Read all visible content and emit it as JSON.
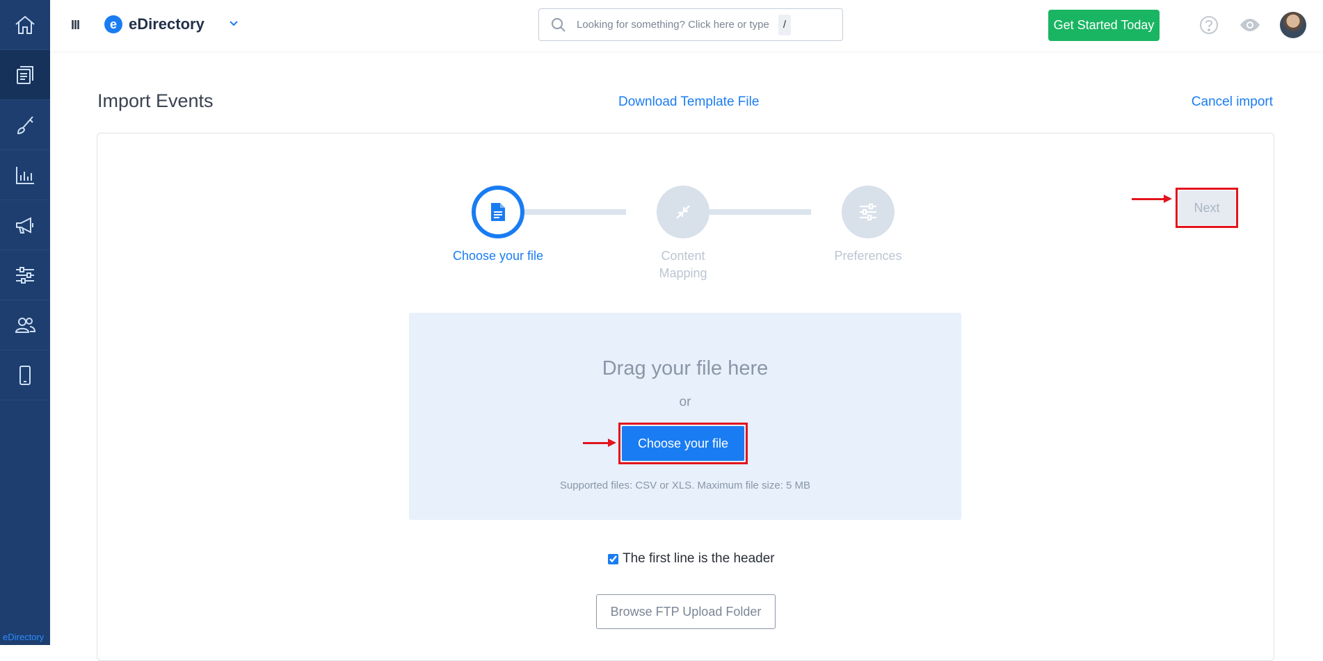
{
  "sidebar": {
    "items": [
      {
        "icon": "home-icon"
      },
      {
        "icon": "content-icon"
      },
      {
        "icon": "brush-icon"
      },
      {
        "icon": "reports-icon"
      },
      {
        "icon": "megaphone-icon"
      },
      {
        "icon": "settings-sliders-icon"
      },
      {
        "icon": "users-icon"
      },
      {
        "icon": "mobile-icon"
      }
    ],
    "brand_label": "eDirectory"
  },
  "header": {
    "menu_toggle": "III",
    "brand_logo_letter": "e",
    "brand_name": "eDirectory",
    "search_placeholder": "Looking for something? Click here or type",
    "search_shortcut": "/",
    "cta_label": "Get Started Today"
  },
  "page": {
    "title": "Import Events",
    "download_template": "Download Template File",
    "cancel_import": "Cancel import"
  },
  "steps": [
    {
      "label": "Choose your file",
      "active": true
    },
    {
      "label": "Content Mapping",
      "active": false
    },
    {
      "label": "Preferences",
      "active": false
    }
  ],
  "next_label": "Next",
  "dropzone": {
    "title": "Drag your file here",
    "or": "or",
    "choose_label": "Choose your file",
    "note": "Supported files: CSV or XLS. Maximum file size: 5 MB"
  },
  "header_checkbox": {
    "label": "The first line is the header",
    "checked": true
  },
  "ftp_label": "Browse FTP Upload Folder",
  "colors": {
    "accent": "#1a7cf2",
    "sidebar": "#1d3e6e",
    "cta": "#19b562",
    "highlight": "#e3141d"
  }
}
